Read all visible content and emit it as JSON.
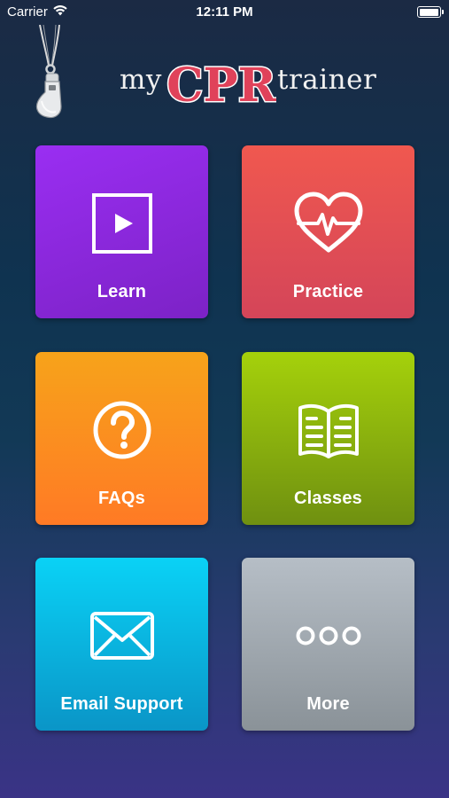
{
  "status_bar": {
    "carrier": "Carrier",
    "time": "12:11 PM",
    "battery_level": 1.0
  },
  "header": {
    "logo_prefix": "my",
    "logo_brand": "CPR",
    "logo_suffix": "trainer",
    "brand_color": "#e0425a"
  },
  "tiles": [
    {
      "label": "Learn",
      "icon": "play-icon",
      "color": "#8a28dc"
    },
    {
      "label": "Practice",
      "icon": "heart-pulse-icon",
      "color": "#e24e55"
    },
    {
      "label": "FAQs",
      "icon": "question-icon",
      "color": "#fb8f20"
    },
    {
      "label": "Classes",
      "icon": "book-icon",
      "color": "#8db30d"
    },
    {
      "label": "Email Support",
      "icon": "envelope-icon",
      "color": "#0ab4de"
    },
    {
      "label": "More",
      "icon": "more-dots-icon",
      "color": "#a0a8b0"
    }
  ]
}
